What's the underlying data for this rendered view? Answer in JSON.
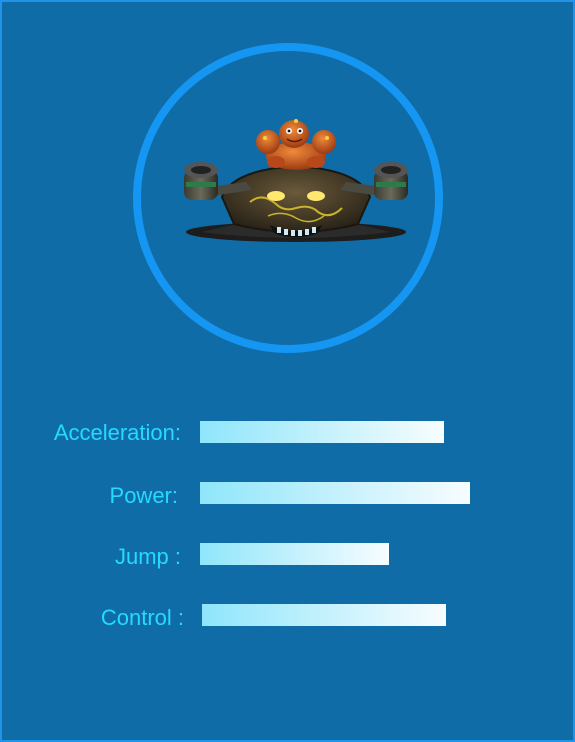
{
  "character": {
    "portrait_icon": "alien-pilot-hover-ship-icon"
  },
  "colors": {
    "background": "#106ca6",
    "frame_border": "#1f94e8",
    "ring": "#1496f2",
    "label_text": "#25d9ff",
    "bar_start": "#8fe6fb",
    "bar_end": "#f7fdff"
  },
  "stats": {
    "acceleration": {
      "label": "Acceleration:",
      "level": 0.84
    },
    "power": {
      "label": "Power:",
      "level": 0.93
    },
    "jump": {
      "label": "Jump :",
      "level": 0.65
    },
    "control": {
      "label": "Control :",
      "level": 0.84
    }
  }
}
